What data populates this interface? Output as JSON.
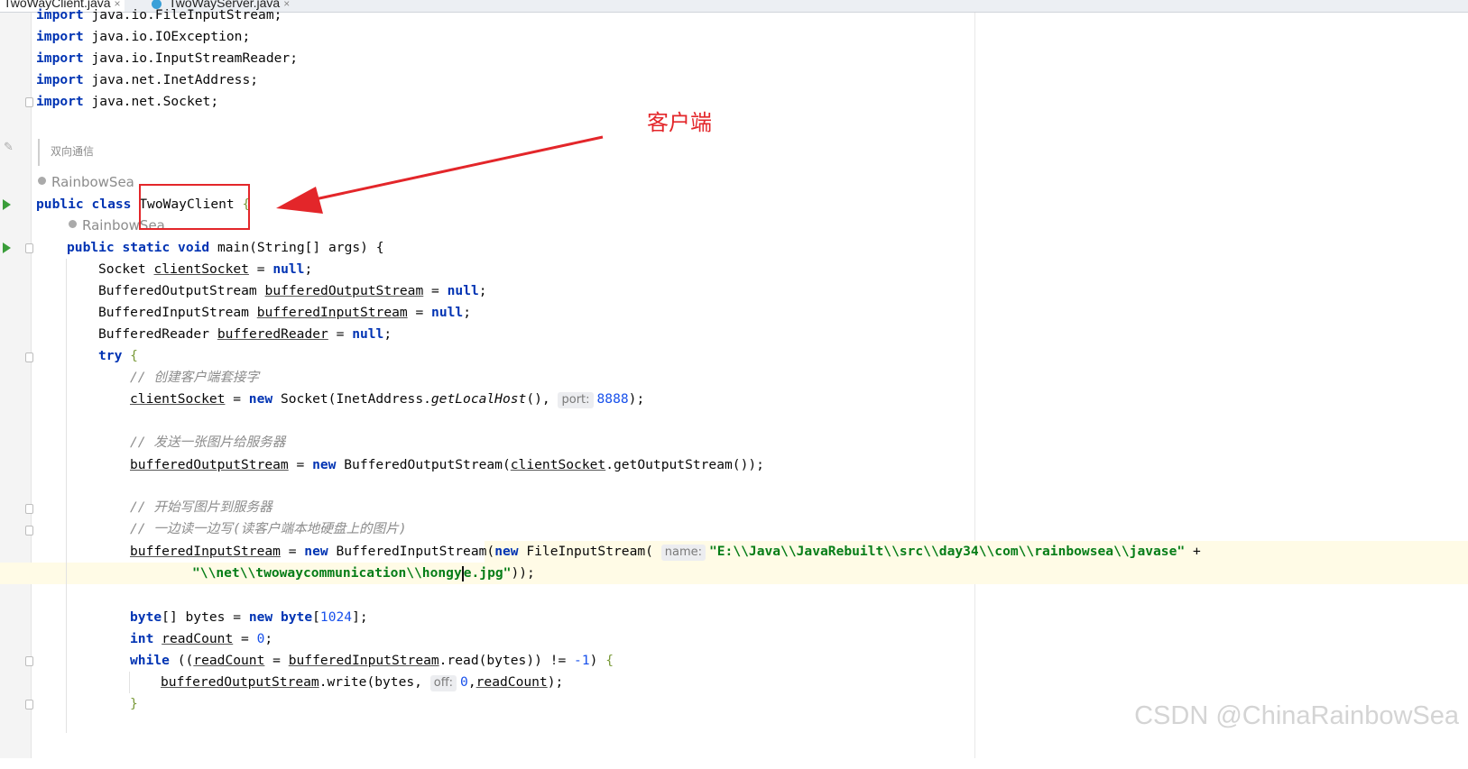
{
  "tabs": [
    {
      "label": "TwoWayClient.java",
      "close": "×"
    },
    {
      "label": "TwoWayServer.java",
      "close": "×"
    }
  ],
  "annotation": {
    "text": "客户端",
    "color": "#e3262a"
  },
  "doc_comment": "双向通信",
  "author": "RainbowSea",
  "watermark": "CSDN @ChinaRainbowSea",
  "colors": {
    "keyword": "#0033b3",
    "string": "#067d17",
    "number": "#1750eb",
    "comment": "#8c8c8c",
    "highlight": "#fffbe6",
    "run": "#3a9d3a"
  },
  "icons": {
    "run": "run-gutter-icon",
    "fold": "fold-marker-icon",
    "edit": "pencil-icon",
    "user": "user-icon"
  },
  "code": {
    "imp": "import",
    "java_io": "java.io.",
    "java_net": "java.net.",
    "FileInputStream": "FileInputStream",
    "IOException": "IOException",
    "InputStreamReader": "InputStreamReader",
    "InetAddress": "InetAddress",
    "Socket": "Socket",
    "semi": ";",
    "public": "public",
    "class": "class",
    "static": "static",
    "void": "void",
    "new": "new",
    "null": "null",
    "try": "try",
    "while": "while",
    "int": "int",
    "byte": "byte",
    "class_name": "TwoWayClient",
    "lbrace": "{",
    "rbrace": "}",
    "main_sig": "main(String[] args) ",
    "clientSocket": "clientSocket",
    "BufferedOutputStream": "BufferedOutputStream",
    "bufferedOutputStream": "bufferedOutputStream",
    "BufferedInputStream": "BufferedInputStream",
    "bufferedInputStream": "bufferedInputStream",
    "BufferedReader": "BufferedReader",
    "bufferedReader": "bufferedReader",
    "eq": " = ",
    "comment1": "// 创建客户端套接字",
    "socket_ctor": "Socket(InetAddress.",
    "getLocalHost": "getLocalHost",
    "paren_comma": "(), ",
    "hint_port": "port:",
    "port": "8888",
    "close_semi": ");",
    "comment2": "// 发送一张图片给服务器",
    "bos_ctor": "BufferedOutputStream(",
    "getOutputStream": ".getOutputStream());",
    "comment3": "// 开始写图片到服务器",
    "comment4": "// 一边读一边写(读客户端本地硬盘上的图片)",
    "bis_ctor": "BufferedInputStream(",
    "fis_ctor": "FileInputStream(",
    "hint_name": "name:",
    "path1": "\"E:\\\\Java\\\\JavaRebuilt\\\\src\\\\day34\\\\com\\\\rainbowsea\\\\javase\"",
    "plus": " +",
    "path2a": "\"\\\\net\\\\twowaycommunication\\\\hongy",
    "path2b": "e.jpg\"",
    "close2": "));",
    "byte_arr": "[] bytes = ",
    "byte_size": "1024",
    "byte_end": "];",
    "readCount": "readCount",
    "zero": "0",
    "while_open": " ((",
    "read_call": ".read(bytes)) != ",
    "minus_one": "-1",
    "close_paren": ") ",
    "write_call": ".write(bytes, ",
    "hint_off": "off:",
    "comma": ","
  }
}
